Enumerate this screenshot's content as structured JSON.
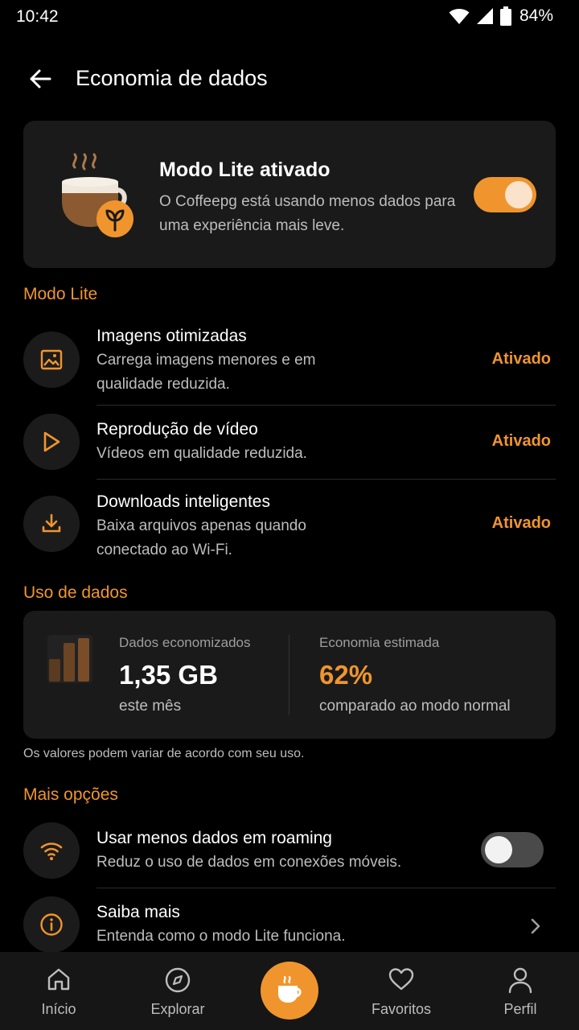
{
  "status_bar": {
    "time": "10:42",
    "battery": "84%"
  },
  "header": {
    "title": "Economia de dados"
  },
  "hero": {
    "title": "Modo Lite ativado",
    "description": "O Coffeepg está usando menos dados para uma experiência mais leve.",
    "toggle_on": true
  },
  "sections": {
    "lite": "Modo Lite",
    "usage": "Uso de dados",
    "more": "Mais opções"
  },
  "lite_items": [
    {
      "title": "Imagens otimizadas",
      "desc": "Carrega imagens menores e em qualidade reduzida.",
      "status": "Ativado",
      "icon": "image-icon"
    },
    {
      "title": "Reprodução de vídeo",
      "desc": "Vídeos em qualidade reduzida.",
      "status": "Ativado",
      "icon": "play-icon"
    },
    {
      "title": "Downloads inteligentes",
      "desc": "Baixa arquivos apenas quando conectado ao Wi-Fi.",
      "status": "Ativado",
      "icon": "download-icon"
    }
  ],
  "usage": {
    "saved_label": "Dados economizados",
    "saved_value": "1,35 GB",
    "saved_period": "este mês",
    "estimate_label": "Economia estimada",
    "estimate_value": "62%",
    "estimate_sub": "comparado ao modo normal",
    "note": "Os valores podem variar de acordo com seu uso."
  },
  "more_items": [
    {
      "title": "Usar menos dados em roaming",
      "desc": "Reduz o uso de dados em conexões móveis.",
      "toggle_on": false,
      "icon": "wifi-icon"
    },
    {
      "title": "Saiba mais",
      "desc": "Entenda como o modo Lite funciona.",
      "icon": "info-icon"
    }
  ],
  "nav": {
    "home": "Início",
    "explore": "Explorar",
    "favorites": "Favoritos",
    "profile": "Perfil"
  },
  "colors": {
    "accent": "#f0952e",
    "background": "#000000",
    "card": "#1a1a1a"
  }
}
